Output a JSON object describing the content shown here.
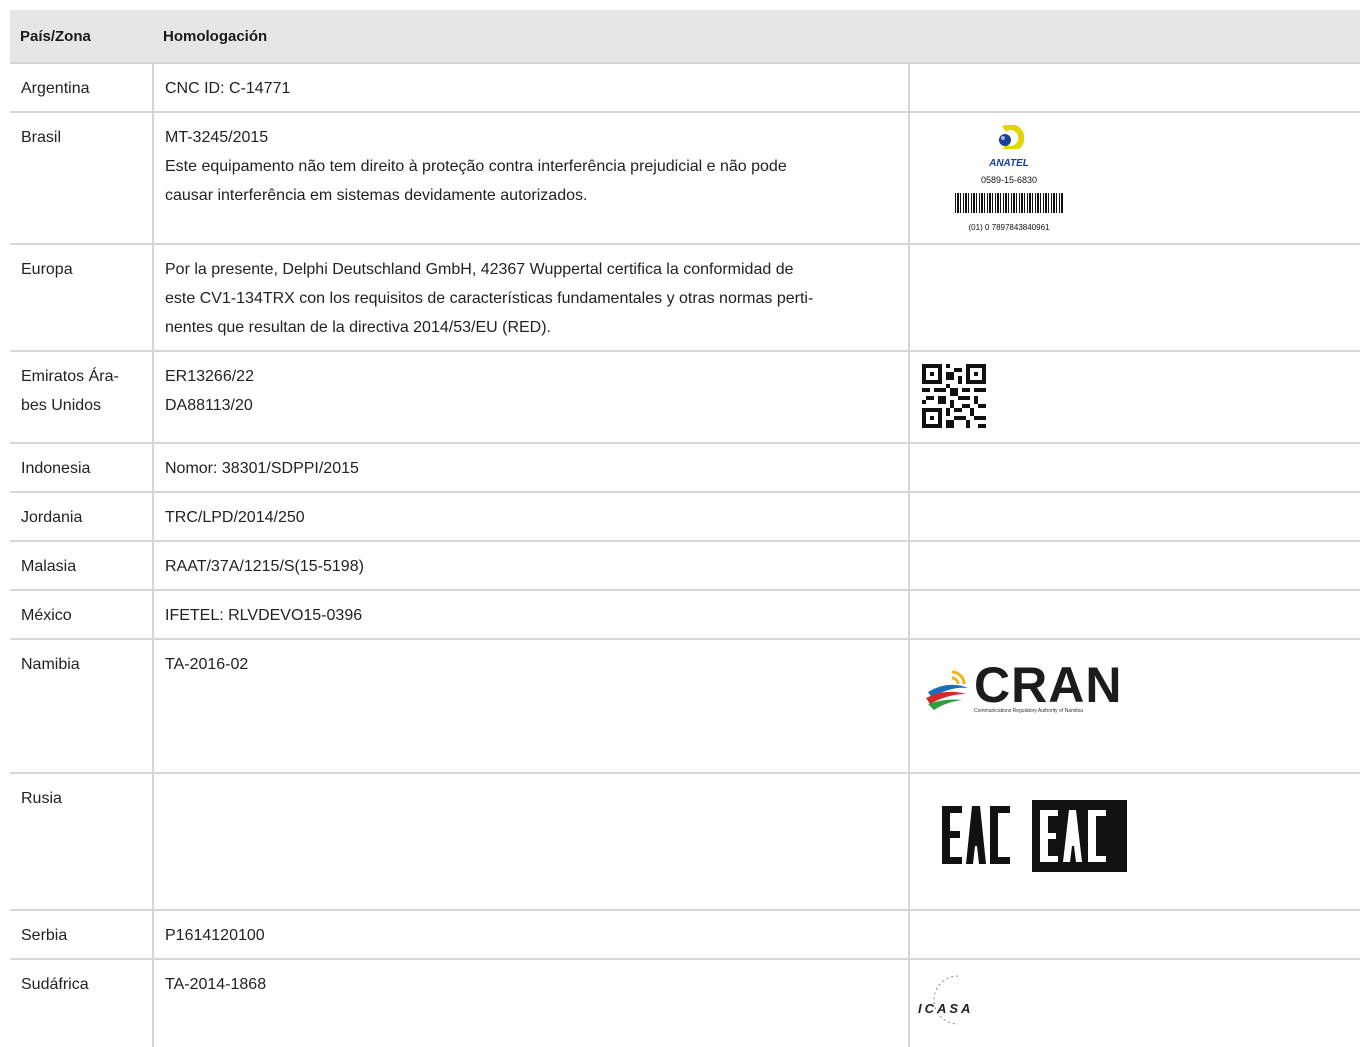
{
  "headers": {
    "country": "País/Zona",
    "approval": "Homologación"
  },
  "rows": [
    {
      "country": "Argentina",
      "approval": [
        "CNC ID: C-14771"
      ]
    },
    {
      "country": "Brasil",
      "approval": [
        "MT-3245/2015",
        "Este equipamento não tem direito à proteção contra interferência prejudicial e não pode",
        "causar interferência em sistemas devidamente autorizados."
      ],
      "logo": {
        "word": "ANATEL",
        "number": "0589-15-6830",
        "barcode_number": "(01) 0 7897843840961"
      }
    },
    {
      "country": "Europa",
      "approval": [
        "Por la presente, Delphi Deutschland GmbH, 42367 Wuppertal certifica la conformidad de",
        "este CV1-134TRX con los requisitos de características fundamentales y otras normas perti-",
        "nentes que resultan de la directiva 2014/53/EU (RED)."
      ]
    },
    {
      "country": "Emiratos Ára-\nbes Unidos",
      "country_lines": [
        "Emiratos Ára-",
        "bes Unidos"
      ],
      "approval": [
        "ER13266/22",
        "DA88113/20"
      ]
    },
    {
      "country": "Indonesia",
      "approval": [
        "Nomor: 38301/SDPPI/2015"
      ]
    },
    {
      "country": "Jordania",
      "approval": [
        "TRC/LPD/2014/250"
      ]
    },
    {
      "country": "Malasia",
      "approval": [
        "RAAT/37A/1215/S(15-5198)"
      ]
    },
    {
      "country": "México",
      "approval": [
        "IFETEL: RLVDEVO15-0396"
      ]
    },
    {
      "country": "Namibia",
      "approval": [
        "TA-2016-02"
      ],
      "logo": {
        "word": "CRAN",
        "tagline": "Communications Regulatory Authority of Namibia"
      }
    },
    {
      "country": "Rusia",
      "approval": [],
      "logo": {
        "word": "EAC"
      }
    },
    {
      "country": "Serbia",
      "approval": [
        "P1614120100"
      ]
    },
    {
      "country": "Sudáfrica",
      "approval": [
        "TA-2014-1868"
      ],
      "logo": {
        "word": "ICASA"
      }
    }
  ],
  "colors": {
    "header_bg": "#e6e6e6",
    "border": "#d6d6d6",
    "anatel_blue": "#1a3f9a",
    "anatel_yellow": "#e3d400"
  }
}
